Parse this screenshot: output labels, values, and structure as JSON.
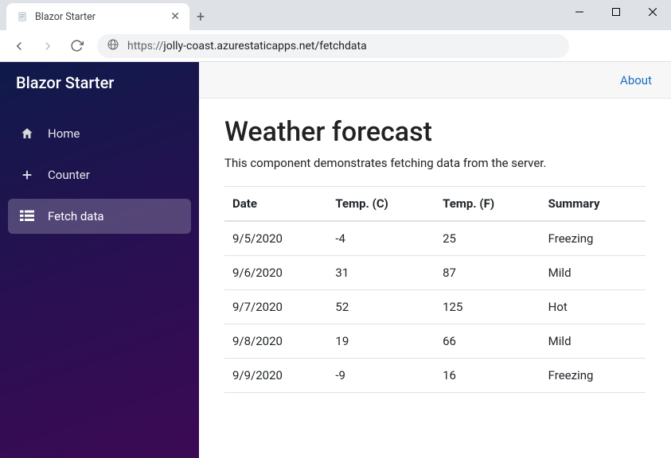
{
  "browser": {
    "tab_title": "Blazor Starter",
    "url_proto": "https://",
    "url_rest": "jolly-coast.azurestaticapps.net/fetchdata"
  },
  "sidebar": {
    "brand": "Blazor Starter",
    "items": [
      {
        "label": "Home",
        "icon": "home-icon",
        "active": false
      },
      {
        "label": "Counter",
        "icon": "plus-icon",
        "active": false
      },
      {
        "label": "Fetch data",
        "icon": "list-icon",
        "active": true
      }
    ]
  },
  "topbar": {
    "about_label": "About"
  },
  "page": {
    "title": "Weather forecast",
    "subtitle": "This component demonstrates fetching data from the server."
  },
  "table": {
    "columns": [
      "Date",
      "Temp. (C)",
      "Temp. (F)",
      "Summary"
    ],
    "rows": [
      {
        "date": "9/5/2020",
        "tempC": "-4",
        "tempF": "25",
        "summary": "Freezing"
      },
      {
        "date": "9/6/2020",
        "tempC": "31",
        "tempF": "87",
        "summary": "Mild"
      },
      {
        "date": "9/7/2020",
        "tempC": "52",
        "tempF": "125",
        "summary": "Hot"
      },
      {
        "date": "9/8/2020",
        "tempC": "19",
        "tempF": "66",
        "summary": "Mild"
      },
      {
        "date": "9/9/2020",
        "tempC": "-9",
        "tempF": "16",
        "summary": "Freezing"
      }
    ]
  }
}
